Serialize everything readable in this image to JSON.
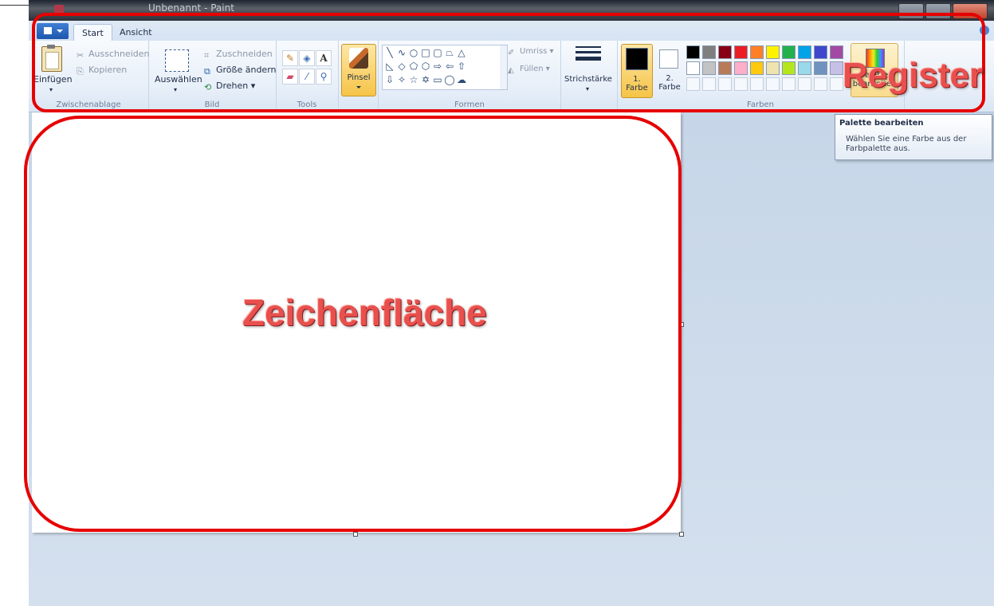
{
  "window": {
    "title": "Unbenannt - Paint"
  },
  "tabs": [
    {
      "label": "Start",
      "active": true
    },
    {
      "label": "Ansicht",
      "active": false
    }
  ],
  "ribbon": {
    "clipboard": {
      "paste_label": "Einfügen",
      "cut_label": "Ausschneiden",
      "copy_label": "Kopieren",
      "group_label": "Zwischenablage"
    },
    "image": {
      "select_label": "Auswählen",
      "crop_label": "Zuschneiden",
      "resize_label": "Größe ändern",
      "rotate_label": "Drehen",
      "group_label": "Bild"
    },
    "tools": {
      "group_label": "Tools",
      "items": [
        "pencil-icon",
        "fill-icon",
        "text-icon",
        "eraser-icon",
        "color-picker-icon",
        "magnifier-icon"
      ]
    },
    "brushes": {
      "label": "Pinsel"
    },
    "shapes": {
      "outline_label": "Umriss",
      "fill_label": "Füllen",
      "group_label": "Formen"
    },
    "stroke": {
      "label": "Strichstärke"
    },
    "colors": {
      "color1_label_line1": "1.",
      "color1_label_line2": "Farbe",
      "color2_label_line1": "2.",
      "color2_label_line2": "Farbe",
      "group_label": "Farben",
      "edit_palette_label": "Palette bearbeiten",
      "color1_value": "#000000",
      "color2_value": "#ffffff",
      "palette_row1": [
        "#000000",
        "#7f7f7f",
        "#880015",
        "#ed1c24",
        "#ff7f27",
        "#fff200",
        "#22b14c",
        "#00a2e8",
        "#3f48cc",
        "#a349a4"
      ],
      "palette_row2": [
        "#ffffff",
        "#c3c3c3",
        "#b97a57",
        "#ffaec9",
        "#ffc90e",
        "#efe4b0",
        "#b5e61d",
        "#99d9ea",
        "#7092be",
        "#c8bfe7"
      ]
    }
  },
  "tooltip": {
    "title": "Palette bearbeiten",
    "description": "Wählen Sie eine Farbe aus der Farbpalette aus."
  },
  "annotations": {
    "ribbon_label": "Register",
    "canvas_label": "Zeichenfläche",
    "color": "#e60000"
  }
}
